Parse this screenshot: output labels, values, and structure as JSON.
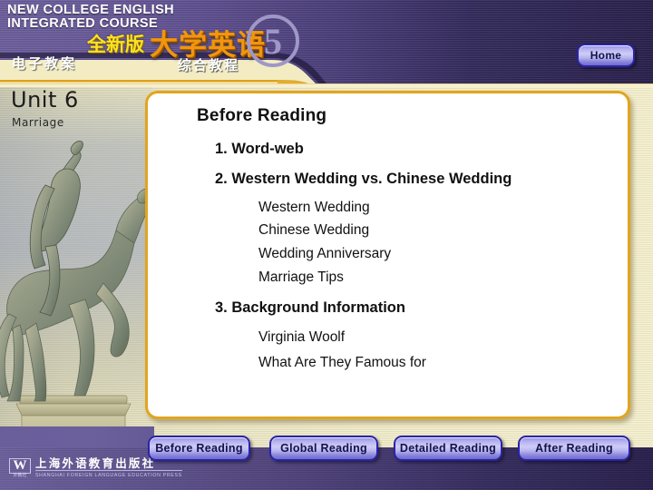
{
  "header": {
    "brand_en_line1": "NEW COLLEGE ENGLISH",
    "brand_en_line2": "INTEGRATED COURSE",
    "brand_cn_small": "电子教案",
    "brand_cn_yellow": "全新版",
    "brand_cn_big": "大学英语",
    "brand_cn_sub": "综合教程",
    "volume_number": "5",
    "home_label": "Home"
  },
  "unit": {
    "title": "Unit 6",
    "subtitle": "Marriage"
  },
  "panel": {
    "title": "Before Reading",
    "items": [
      {
        "level": 1,
        "text": "1. Word-web"
      },
      {
        "level": 1,
        "text": "2. Western Wedding vs. Chinese Wedding"
      },
      {
        "level": 2,
        "text": "Western Wedding"
      },
      {
        "level": 2,
        "text": "Chinese Wedding"
      },
      {
        "level": 2,
        "text": "Wedding Anniversary"
      },
      {
        "level": 2,
        "text": "Marriage Tips"
      },
      {
        "level": 1,
        "text": "3. Background Information"
      },
      {
        "level": 2,
        "text": "Virginia Woolf"
      },
      {
        "level": 2,
        "text": "What Are They Famous for"
      }
    ]
  },
  "nav": {
    "buttons": [
      {
        "label": "Before Reading"
      },
      {
        "label": "Global Reading"
      },
      {
        "label": "Detailed Reading"
      },
      {
        "label": "After  Reading"
      }
    ]
  },
  "publisher": {
    "mark": "W",
    "mark_sub": "外教社",
    "name_cn": "上海外语教育出版社",
    "name_en": "SHANGHAI FOREIGN LANGUAGE EDUCATION PRESS"
  },
  "artwork": {
    "statue_caption": "equestrian-statue"
  },
  "colors": {
    "header_purple_light": "#6d5f9e",
    "header_purple_dark": "#281f4c",
    "panel_border_gold": "#e2a51d",
    "background_cream": "#efe9c4",
    "title_orange": "#f0960f",
    "title_yellow": "#ffe21f",
    "button_blue": "#2a24a8"
  }
}
